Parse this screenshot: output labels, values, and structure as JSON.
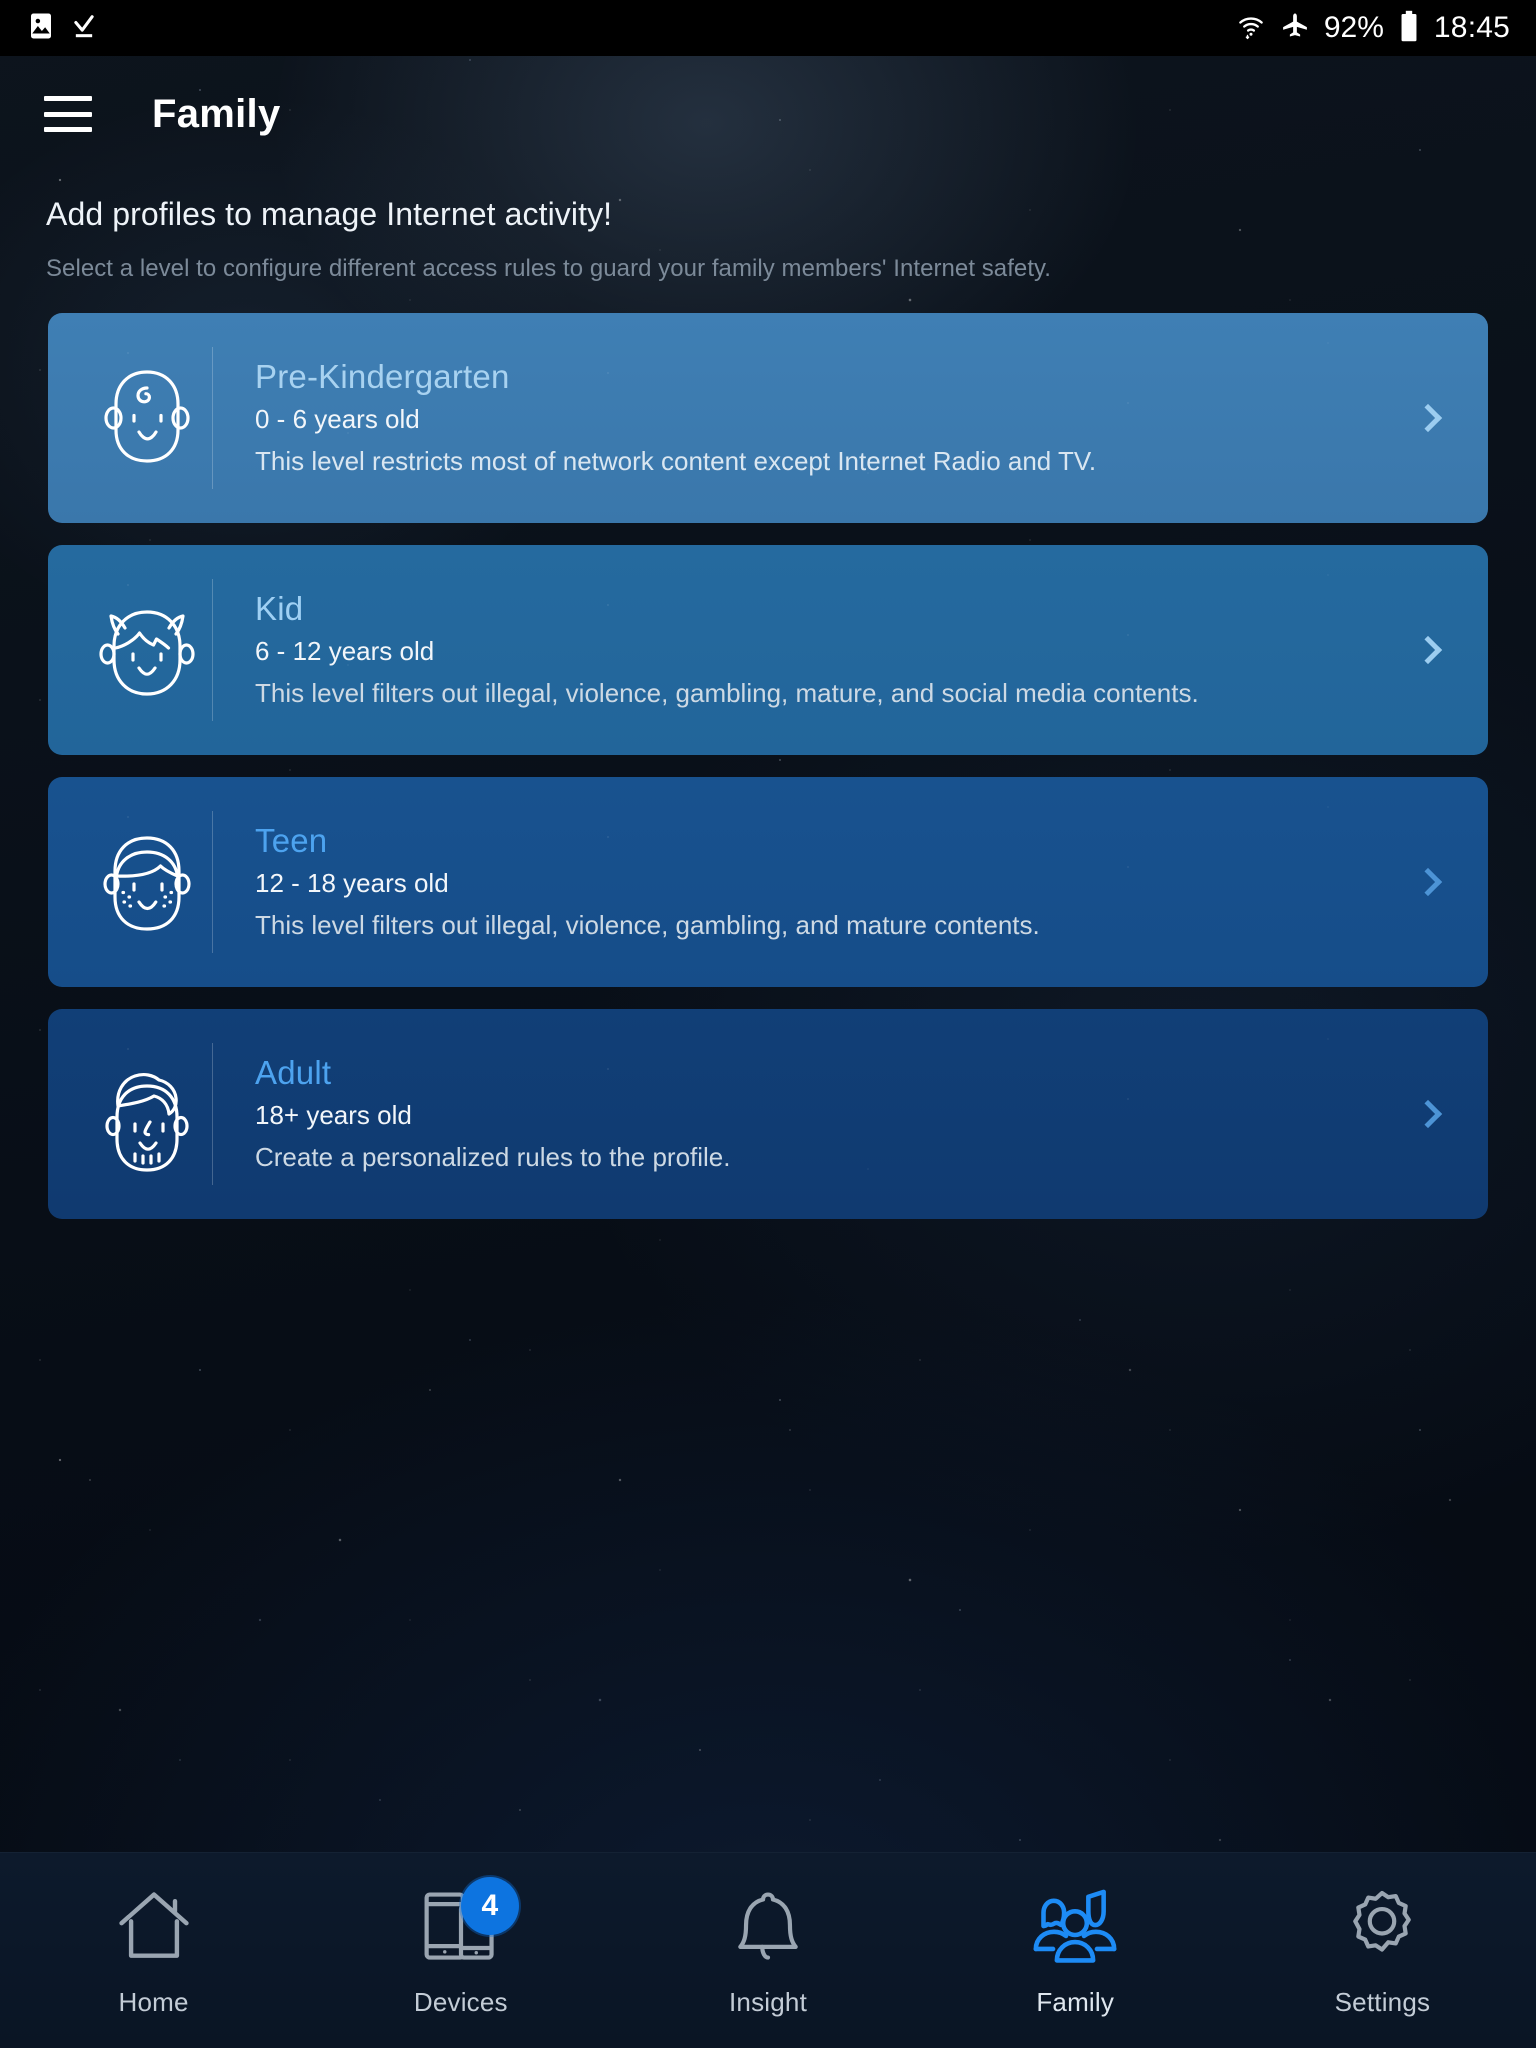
{
  "statusbar": {
    "icons_left": [
      "image-icon",
      "download-complete-icon"
    ],
    "icons_right": [
      "wifi-icon",
      "airplane-mode-icon",
      "battery-icon"
    ],
    "battery_percent": "92%",
    "time": "18:45"
  },
  "header": {
    "menu_icon": "hamburger-menu-icon",
    "title": "Family"
  },
  "intro": {
    "title": "Add profiles to manage Internet activity!",
    "subtitle": "Select a level to configure different access rules to guard your family members' Internet safety."
  },
  "profiles": [
    {
      "icon": "baby-face-icon",
      "title": "Pre-Kindergarten",
      "age": "0 - 6 years old",
      "description": "This level restricts most of network content except Internet Radio and TV.",
      "chevron": "chevron-right-icon",
      "color": "#3f7fb4"
    },
    {
      "icon": "kid-face-icon",
      "title": "Kid",
      "age": "6 - 12 years old",
      "description": "This level filters out illegal, violence, gambling, mature, and social media contents.",
      "chevron": "chevron-right-icon",
      "color": "#256a9f"
    },
    {
      "icon": "teen-face-icon",
      "title": "Teen",
      "age": "12 - 18 years old",
      "description": "This level filters out illegal, violence, gambling, and mature contents.",
      "chevron": "chevron-right-icon",
      "color": "#18528f"
    },
    {
      "icon": "adult-face-icon",
      "title": "Adult",
      "age": "18+ years old",
      "description": "Create a personalized rules to the profile.",
      "chevron": "chevron-right-icon",
      "color": "#113f77"
    }
  ],
  "bottom_nav": {
    "active": "Family",
    "accent_color": "#0d74e0",
    "items": [
      {
        "label": "Home",
        "icon": "home-icon",
        "badge": null,
        "active": false
      },
      {
        "label": "Devices",
        "icon": "devices-icon",
        "badge": "4",
        "active": false
      },
      {
        "label": "Insight",
        "icon": "bell-icon",
        "badge": null,
        "active": false
      },
      {
        "label": "Family",
        "icon": "family-group-icon",
        "badge": null,
        "active": true
      },
      {
        "label": "Settings",
        "icon": "gear-icon",
        "badge": null,
        "active": false
      }
    ]
  }
}
